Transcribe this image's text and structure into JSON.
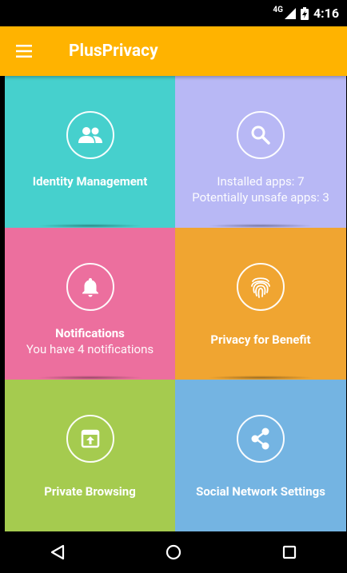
{
  "status_bar": {
    "network": "4G",
    "time": "4:16"
  },
  "app_bar": {
    "title": "PlusPrivacy"
  },
  "tiles": [
    {
      "title": "Identity Management",
      "sub": "",
      "color": "#46D0CD",
      "icon": "people-icon"
    },
    {
      "title": "",
      "sub": "Installed apps: 7",
      "sub2": "Potentially unsafe apps: 3",
      "color": "#B8B8F5",
      "icon": "search-icon"
    },
    {
      "title": "Notifications",
      "sub": "You have 4 notifications",
      "color": "#EC6F9E",
      "icon": "bell-icon"
    },
    {
      "title": "Privacy for Benefit",
      "sub": "",
      "color": "#F0A531",
      "icon": "fingerprint-icon"
    },
    {
      "title": "Private Browsing",
      "sub": "",
      "color": "#A5CB4F",
      "icon": "browser-icon"
    },
    {
      "title": "Social Network Settings",
      "sub": "",
      "color": "#74B4E2",
      "icon": "share-icon"
    }
  ]
}
